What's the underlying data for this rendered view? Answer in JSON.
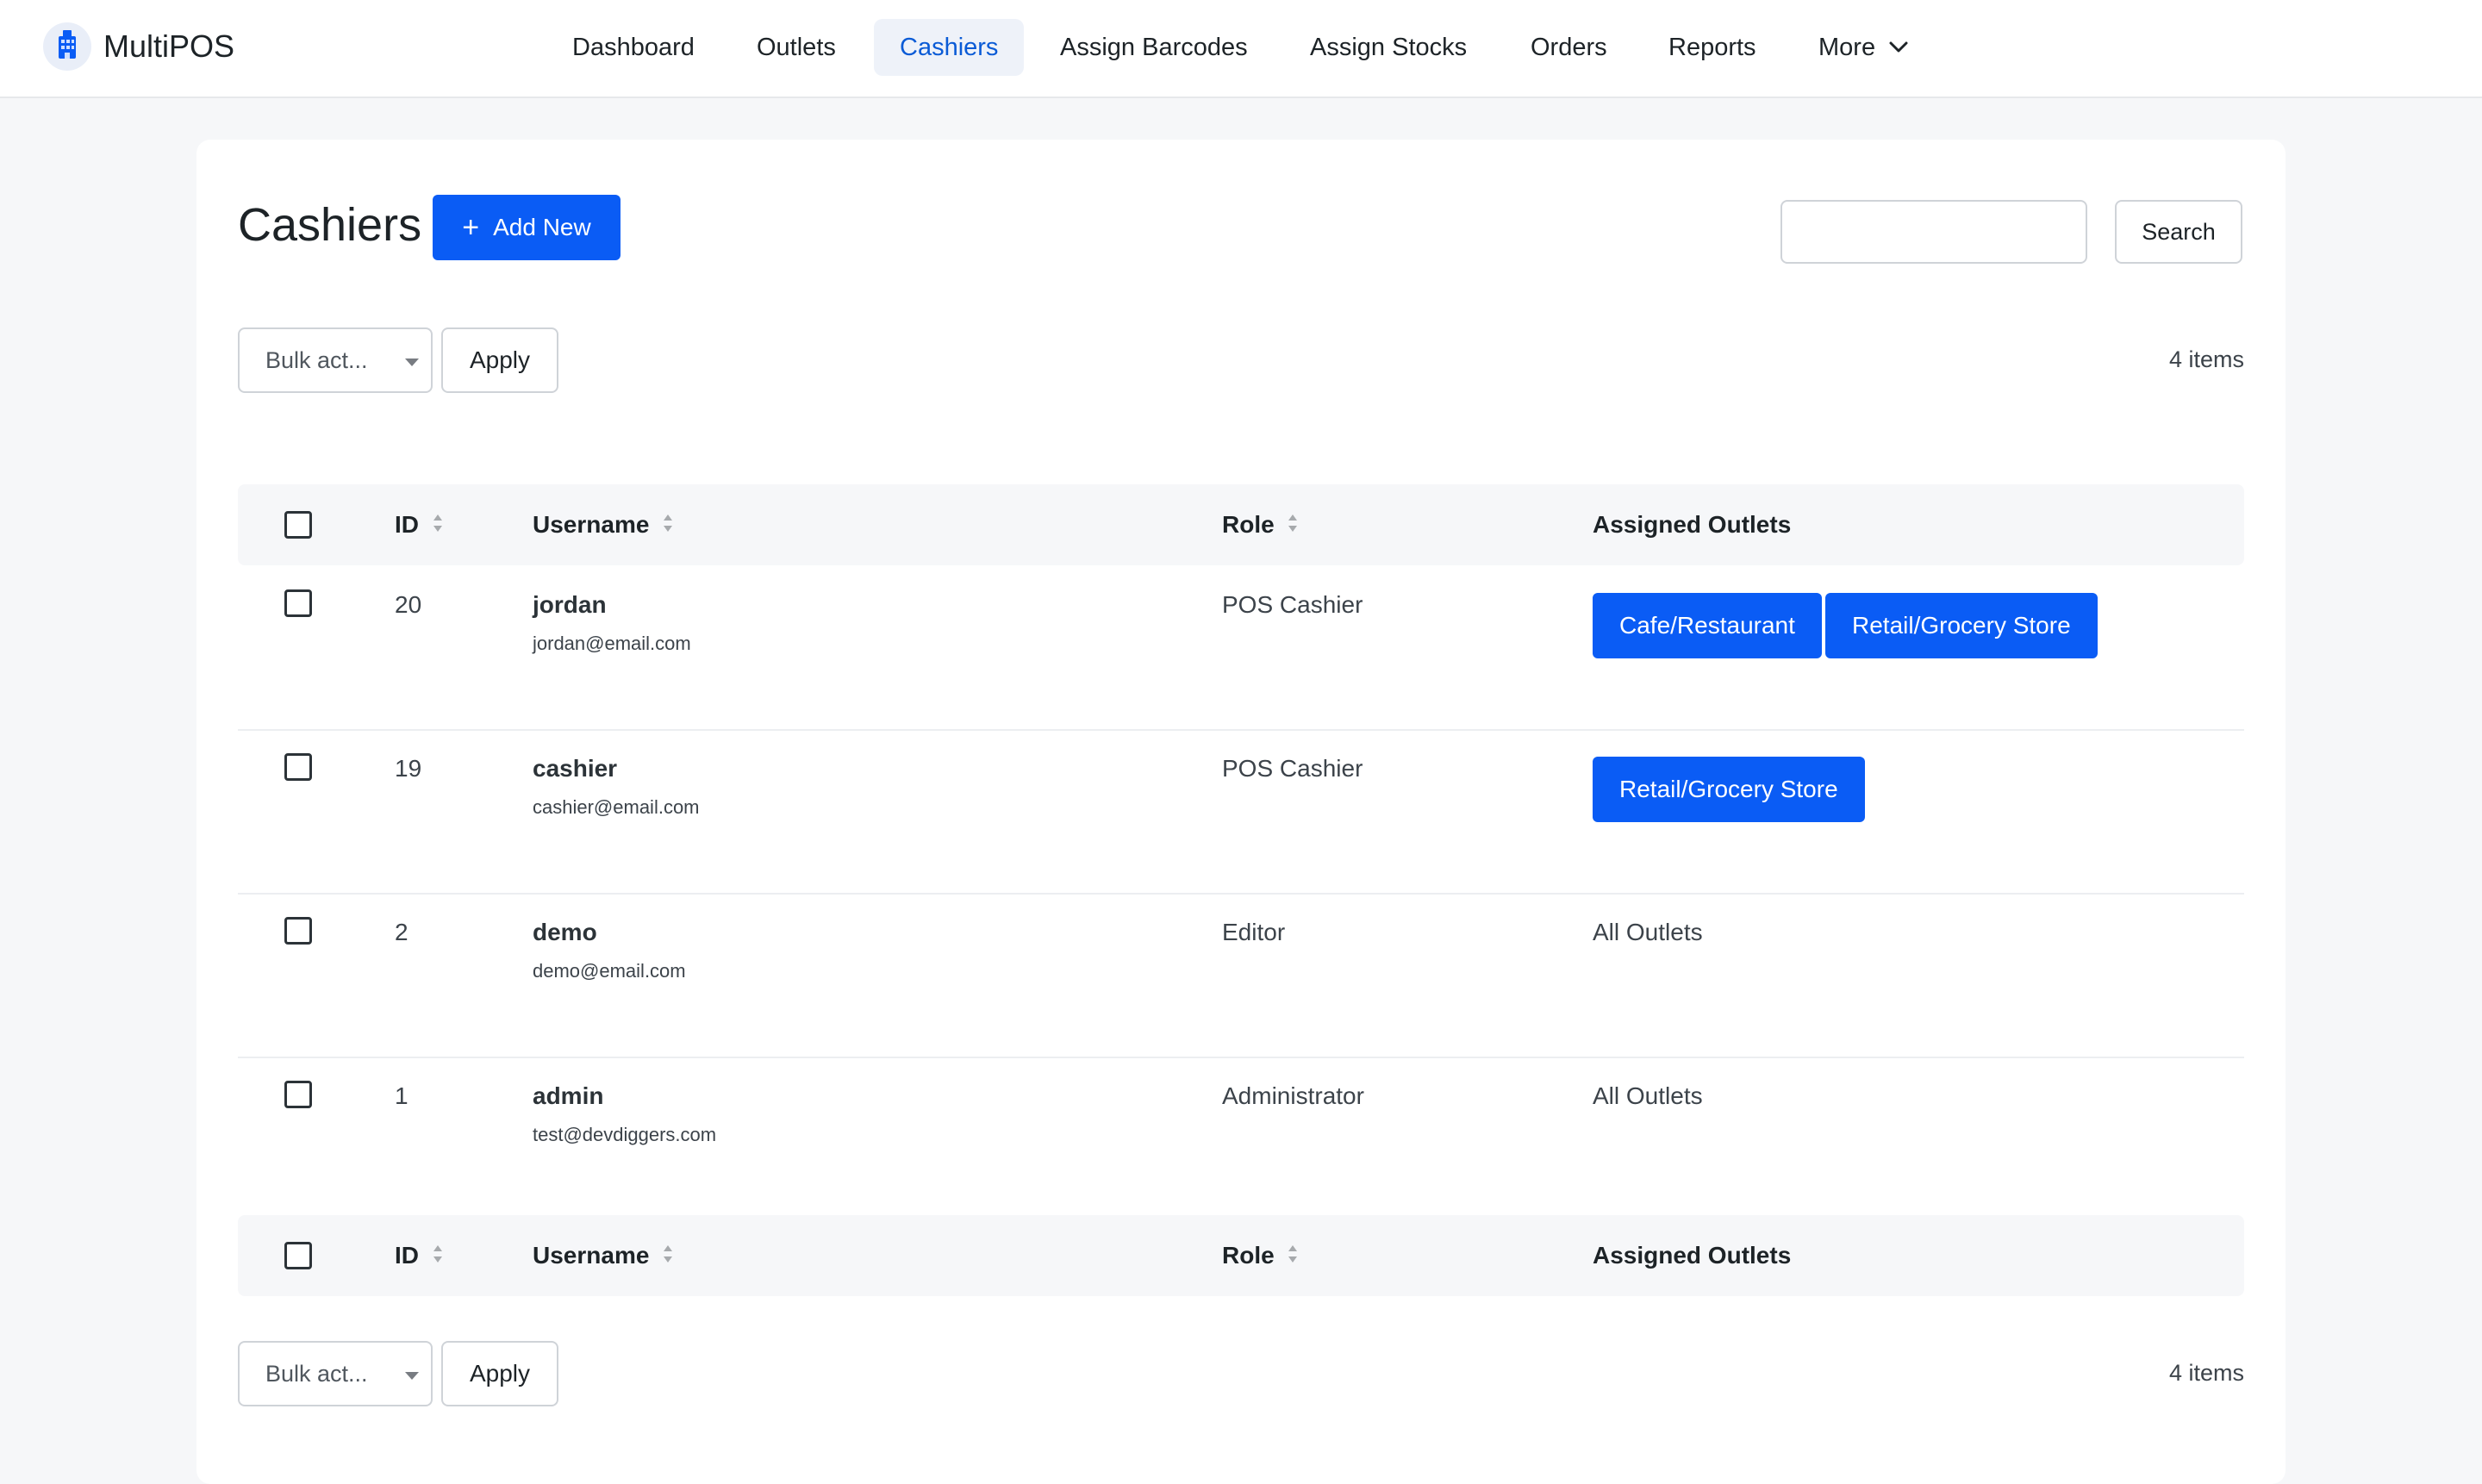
{
  "app": {
    "name": "MultiPOS",
    "accent_color": "#0a5cf5",
    "logo_icon": "building-icon"
  },
  "nav": {
    "items": [
      {
        "label": "Dashboard",
        "active": false
      },
      {
        "label": "Outlets",
        "active": false
      },
      {
        "label": "Cashiers",
        "active": true
      },
      {
        "label": "Assign Barcodes",
        "active": false
      },
      {
        "label": "Assign Stocks",
        "active": false
      },
      {
        "label": "Orders",
        "active": false
      },
      {
        "label": "Reports",
        "active": false
      },
      {
        "label": "More",
        "active": false,
        "icon": "chevron-down-icon"
      }
    ]
  },
  "page": {
    "title": "Cashiers",
    "add_new_label": "Add New",
    "search_value": "",
    "search_button_label": "Search"
  },
  "bulk": {
    "select_label": "Bulk act...",
    "apply_label": "Apply",
    "items_count": "4 items"
  },
  "table": {
    "headers": {
      "id": "ID",
      "username": "Username",
      "role": "Role",
      "assigned_outlets": "Assigned Outlets"
    },
    "rows": [
      {
        "id": "20",
        "username": "jordan",
        "email": "jordan@email.com",
        "role": "POS Cashier",
        "outlets": [
          "Cafe/Restaurant",
          "Retail/Grocery Store"
        ],
        "outlets_text": ""
      },
      {
        "id": "19",
        "username": "cashier",
        "email": "cashier@email.com",
        "role": "POS Cashier",
        "outlets": [
          "Retail/Grocery Store"
        ],
        "outlets_text": ""
      },
      {
        "id": "2",
        "username": "demo",
        "email": "demo@email.com",
        "role": "Editor",
        "outlets": [],
        "outlets_text": "All Outlets"
      },
      {
        "id": "1",
        "username": "admin",
        "email": "test@devdiggers.com",
        "role": "Administrator",
        "outlets": [],
        "outlets_text": "All Outlets"
      }
    ]
  }
}
